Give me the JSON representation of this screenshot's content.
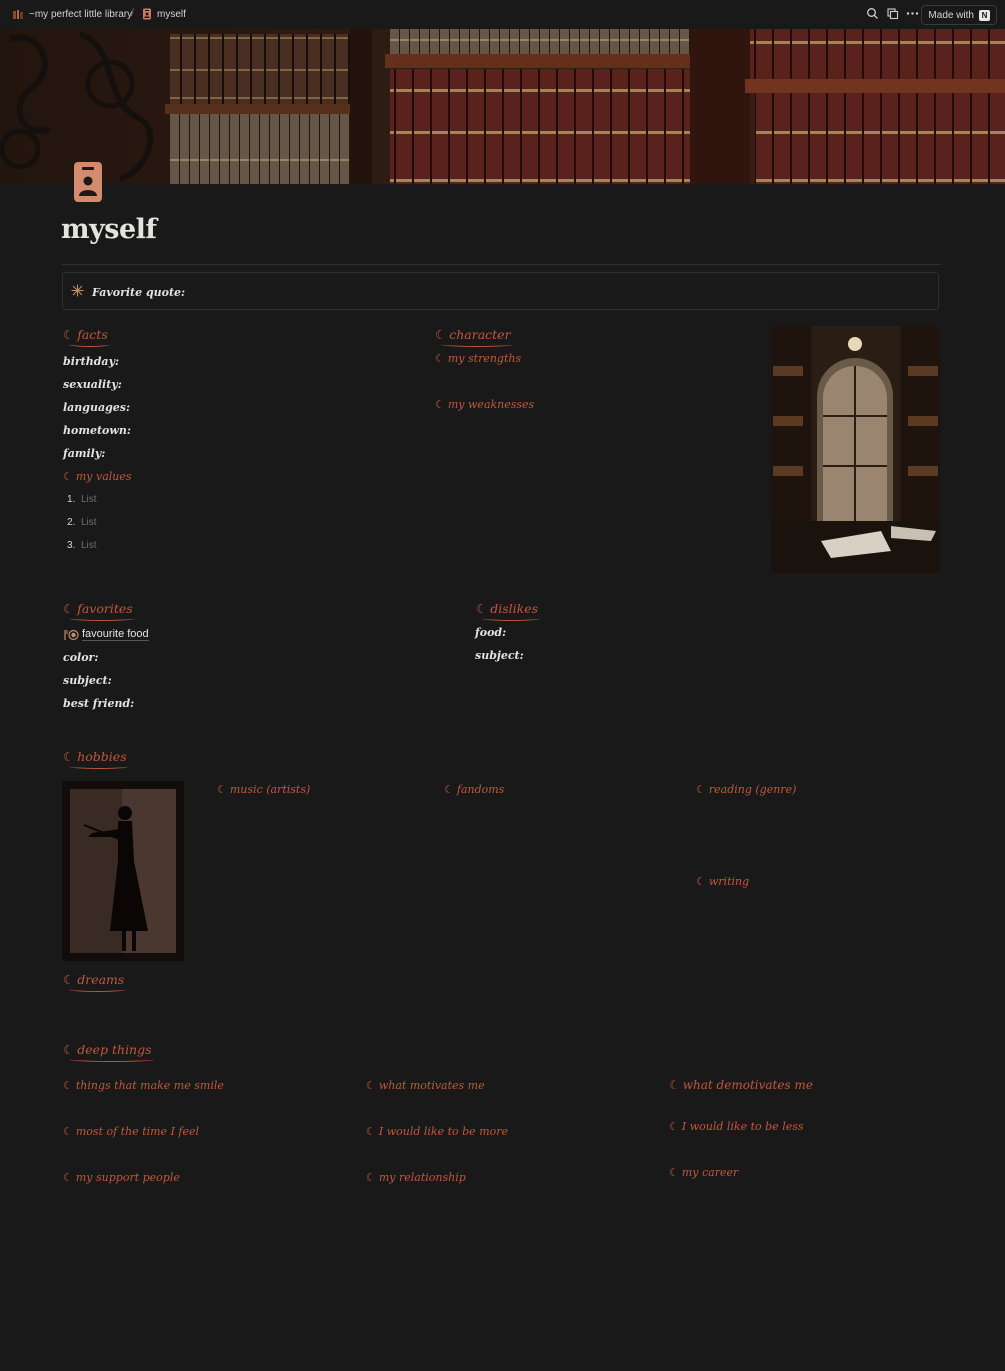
{
  "topbar": {
    "breadcrumb_workspace": "~my perfect little library",
    "breadcrumb_separator": "/",
    "breadcrumb_page": "myself",
    "made_with": "Made with"
  },
  "page": {
    "title": "myself"
  },
  "callout": {
    "icon": "sparkle-icon",
    "label": "Favorite quote:"
  },
  "facts": {
    "heading": "facts",
    "props": [
      "birthday:",
      "sexuality:",
      "languages:",
      "hometown:",
      "family:"
    ],
    "values_heading": "my values",
    "values_list": [
      {
        "num": "1.",
        "text": "List"
      },
      {
        "num": "2.",
        "text": "List"
      },
      {
        "num": "3.",
        "text": "List"
      }
    ]
  },
  "character": {
    "heading": "character",
    "strengths": "my strengths",
    "weaknesses": "my weaknesses"
  },
  "favorites": {
    "heading": "favorites",
    "food_link": "favourite food",
    "props": [
      "color:",
      "subject:",
      "best friend:"
    ]
  },
  "dislikes": {
    "heading": "dislikes",
    "props": [
      "food:",
      "subject:"
    ]
  },
  "hobbies": {
    "heading": "hobbies",
    "music": "music (artists)",
    "fandoms": "fandoms",
    "reading": "reading (genre)",
    "writing": "writing"
  },
  "dreams": {
    "heading": "dreams"
  },
  "deep": {
    "heading": "deep things",
    "smile": "things that make me smile",
    "motivates": "what motivates me",
    "demotivates": "what demotivates me",
    "feel": "most of the time I feel",
    "more": "I would like to be more",
    "less": "I would like to be less",
    "support": "my support people",
    "relationship": "my relationship",
    "career": "my career"
  },
  "moon_glyph": "☾",
  "colors": {
    "accent": "#c1583d",
    "background": "#191919",
    "text": "#e3e3e1"
  }
}
